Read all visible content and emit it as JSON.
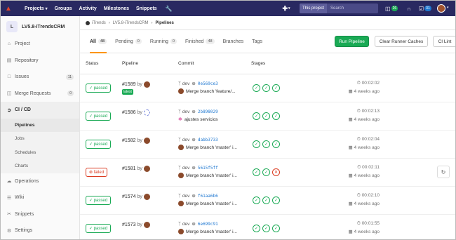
{
  "topnav": {
    "menus": [
      {
        "label": "Projects",
        "has_caret": true
      },
      {
        "label": "Groups",
        "has_caret": false
      },
      {
        "label": "Activity",
        "has_caret": false
      },
      {
        "label": "Milestones",
        "has_caret": false
      },
      {
        "label": "Snippets",
        "has_caret": false
      }
    ],
    "search_scope": "This project",
    "search_placeholder": "Search",
    "merge_requests_count": "26",
    "todos_count": "31",
    "accent_color": "#292961"
  },
  "sidebar": {
    "project_initial": "L",
    "project_name": "LV5.8-iTrendsCRM",
    "items": [
      {
        "label": "Project",
        "icon": "house-icon",
        "count": ""
      },
      {
        "label": "Repository",
        "icon": "book-icon",
        "count": ""
      },
      {
        "label": "Issues",
        "icon": "issues-icon",
        "count": "11"
      },
      {
        "label": "Merge Requests",
        "icon": "merge-icon",
        "count": "0"
      },
      {
        "label": "CI / CD",
        "icon": "rocket-icon",
        "count": ""
      },
      {
        "label": "Operations",
        "icon": "cloud-icon",
        "count": ""
      },
      {
        "label": "Wiki",
        "icon": "wiki-icon",
        "count": ""
      },
      {
        "label": "Snippets",
        "icon": "snippet-icon",
        "count": ""
      },
      {
        "label": "Settings",
        "icon": "gear-icon",
        "count": ""
      }
    ],
    "cicd_sub": [
      "Pipelines",
      "Jobs",
      "Schedules",
      "Charts"
    ]
  },
  "breadcrumb": {
    "group": "iTrends",
    "project": "LV5.8-iTrendsCRM",
    "current": "Pipelines"
  },
  "tabs": [
    {
      "label": "All",
      "count": "48"
    },
    {
      "label": "Pending",
      "count": "0"
    },
    {
      "label": "Running",
      "count": "0"
    },
    {
      "label": "Finished",
      "count": "48"
    },
    {
      "label": "Branches",
      "count": ""
    },
    {
      "label": "Tags",
      "count": ""
    }
  ],
  "buttons": {
    "run_pipeline": "Run Pipeline",
    "clear_caches": "Clear Runner Caches",
    "ci_lint": "CI Lint"
  },
  "columns": {
    "status": "Status",
    "pipeline": "Pipeline",
    "commit": "Commit",
    "stages": "Stages"
  },
  "pipelines": [
    {
      "status": "passed",
      "id": "#1589",
      "by": "by",
      "latest": "latest",
      "branch": "dev",
      "sha": "0e569ce3",
      "message": "Merge branch 'feature/...",
      "stages": [
        "passed",
        "passed",
        "passed"
      ],
      "duration": "00:02:02",
      "ago": "4 weeks ago"
    },
    {
      "status": "passed",
      "id": "#1586",
      "by": "by",
      "latest": "",
      "branch": "dev",
      "sha": "2b898029",
      "message": "ajustes servicios",
      "stages": [
        "passed",
        "passed",
        "passed"
      ],
      "duration": "00:02:13",
      "ago": "4 weeks ago"
    },
    {
      "status": "passed",
      "id": "#1582",
      "by": "by",
      "latest": "",
      "branch": "dev",
      "sha": "dabb3733",
      "message": "Merge branch 'master' i...",
      "stages": [
        "passed",
        "passed",
        "passed"
      ],
      "duration": "00:02:04",
      "ago": "4 weeks ago"
    },
    {
      "status": "failed",
      "id": "#1581",
      "by": "by",
      "latest": "",
      "branch": "dev",
      "sha": "5615f5ff",
      "message": "Merge branch 'master' i...",
      "stages": [
        "passed",
        "passed",
        "failed"
      ],
      "duration": "00:02:11",
      "ago": "4 weeks ago"
    },
    {
      "status": "passed",
      "id": "#1574",
      "by": "by",
      "latest": "",
      "branch": "dev",
      "sha": "f61aa6b6",
      "message": "Merge branch 'master' i...",
      "stages": [
        "passed",
        "passed",
        "passed"
      ],
      "duration": "00:02:10",
      "ago": "4 weeks ago"
    },
    {
      "status": "passed",
      "id": "#1573",
      "by": "by",
      "latest": "",
      "branch": "dev",
      "sha": "6e699c91",
      "message": "Merge branch 'master' i...",
      "stages": [
        "passed",
        "passed",
        "passed"
      ],
      "duration": "00:01:55",
      "ago": "4 weeks ago"
    }
  ]
}
